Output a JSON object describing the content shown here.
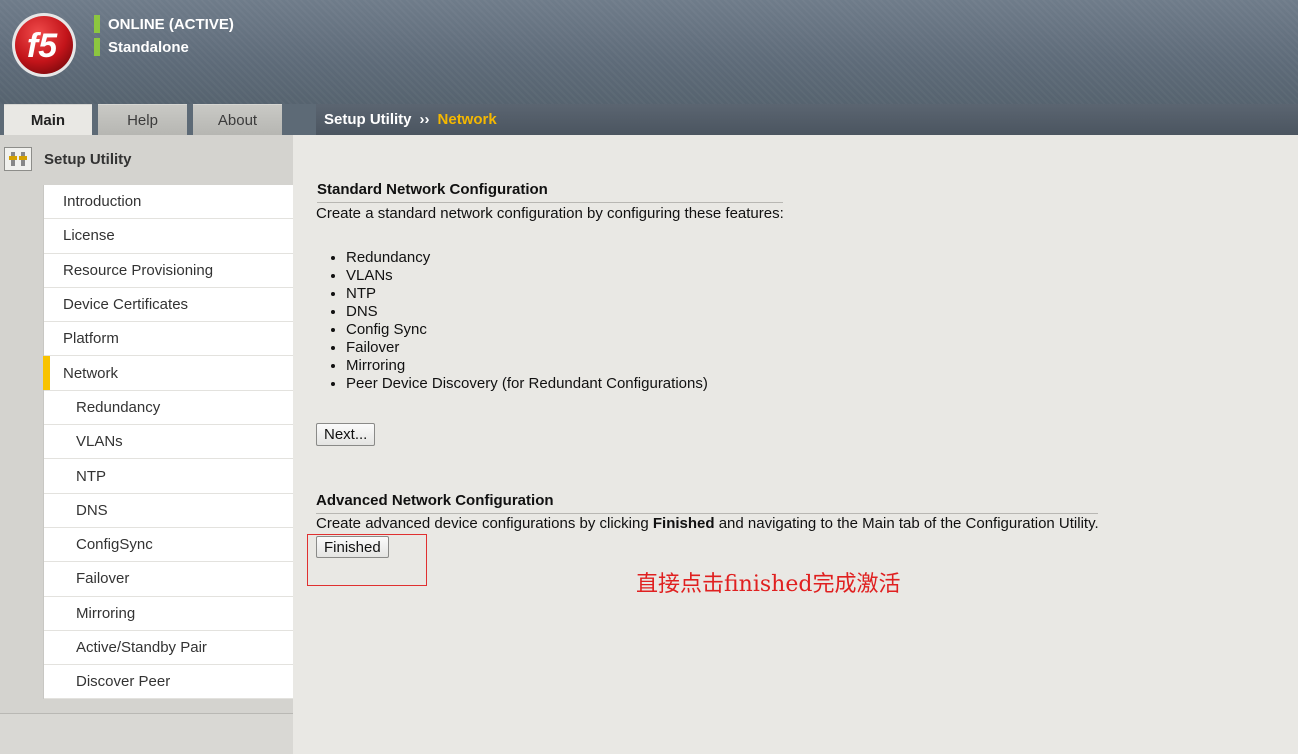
{
  "header": {
    "status_primary": "ONLINE (ACTIVE)",
    "status_secondary": "Standalone",
    "status_color": "#8cc63f",
    "logo_text": "f5"
  },
  "tabs": [
    {
      "label": "Main",
      "active": true
    },
    {
      "label": "Help",
      "active": false
    },
    {
      "label": "About",
      "active": false
    }
  ],
  "breadcrumb": {
    "parent": "Setup Utility",
    "separator": "››",
    "current": "Network"
  },
  "sidebar": {
    "title": "Setup Utility",
    "items": [
      {
        "label": "Introduction"
      },
      {
        "label": "License"
      },
      {
        "label": "Resource Provisioning"
      },
      {
        "label": "Device Certificates"
      },
      {
        "label": "Platform"
      },
      {
        "label": "Network",
        "active": true
      },
      {
        "label": "Redundancy"
      },
      {
        "label": "VLANs"
      },
      {
        "label": "NTP"
      },
      {
        "label": "DNS"
      },
      {
        "label": "ConfigSync"
      },
      {
        "label": "Failover"
      },
      {
        "label": "Mirroring"
      },
      {
        "label": "Active/Standby Pair"
      },
      {
        "label": "Discover Peer"
      }
    ]
  },
  "standard": {
    "title": "Standard Network Configuration",
    "description": "Create a standard network configuration by configuring these features:",
    "features": [
      "Redundancy",
      "VLANs",
      "NTP",
      "DNS",
      "Config Sync",
      "Failover",
      "Mirroring",
      "Peer Device Discovery (for Redundant Configurations)"
    ],
    "next_label": "Next..."
  },
  "advanced": {
    "title": "Advanced Network Configuration",
    "desc_before": "Create advanced device configurations by clicking ",
    "desc_bold": "Finished",
    "desc_after": " and navigating to the Main tab of the Configuration Utility.",
    "finished_label": "Finished"
  },
  "annotation": {
    "text": "直接点击finished完成激活",
    "color": "#e02020"
  }
}
